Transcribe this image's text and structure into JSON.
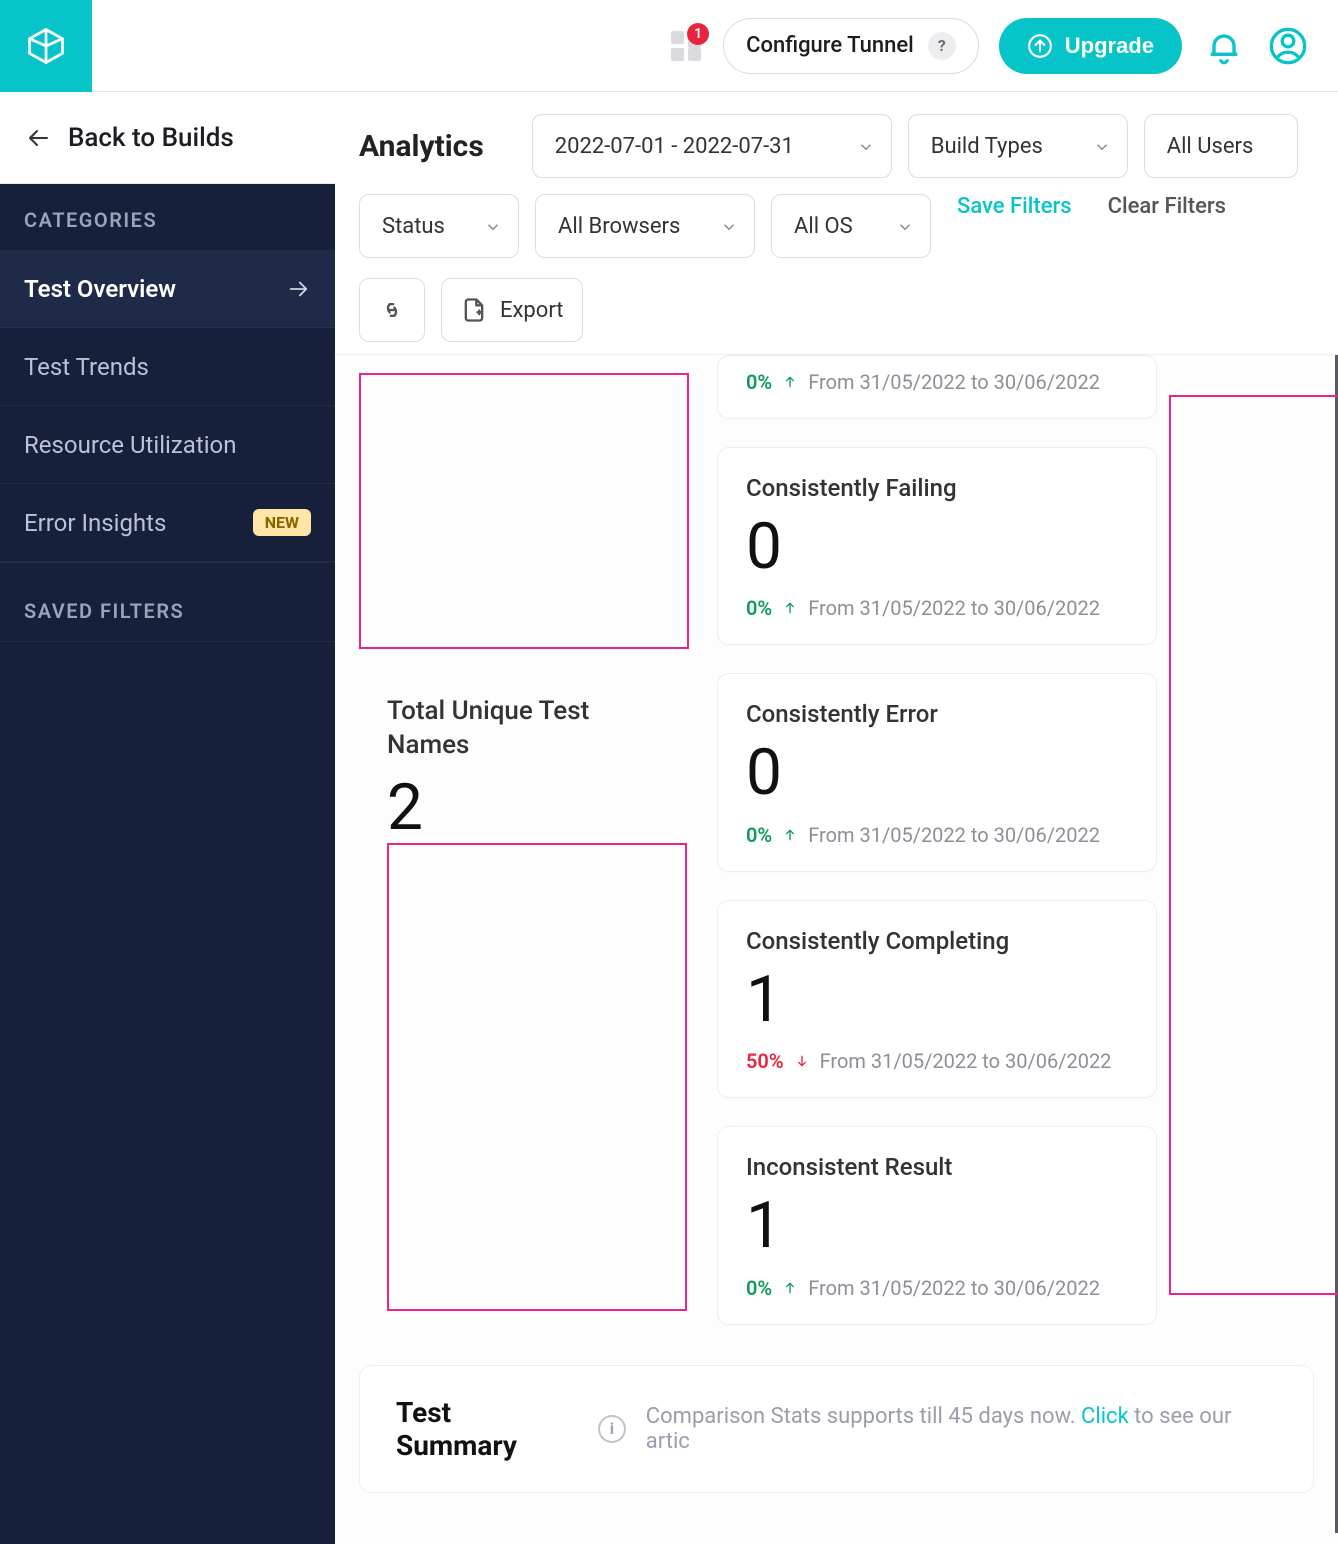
{
  "header": {
    "badge_count": "1",
    "configure_tunnel": "Configure Tunnel",
    "upgrade": "Upgrade"
  },
  "sidebar": {
    "back": "Back to Builds",
    "categories_label": "CATEGORIES",
    "saved_filters_label": "SAVED FILTERS",
    "items": [
      {
        "label": "Test Overview",
        "active": true
      },
      {
        "label": "Test Trends"
      },
      {
        "label": "Resource Utilization"
      },
      {
        "label": "Error Insights",
        "badge": "NEW"
      }
    ]
  },
  "toolbar": {
    "title": "Analytics",
    "date_range": "2022-07-01 - 2022-07-31",
    "build_types": "Build Types",
    "all_users": "All Users",
    "status": "Status",
    "all_browsers": "All Browsers",
    "all_os": "All OS",
    "save_filters": "Save Filters",
    "clear_filters": "Clear Filters",
    "export": "Export"
  },
  "left_card": {
    "title": "Total Unique Test Names",
    "value": "2"
  },
  "cards": [
    {
      "title": "",
      "value": "",
      "pct": "0%",
      "dir": "up",
      "range": "From 31/05/2022 to 30/06/2022",
      "partial": true
    },
    {
      "title": "Consistently Failing",
      "value": "0",
      "pct": "0%",
      "dir": "up",
      "range": "From 31/05/2022 to 30/06/2022"
    },
    {
      "title": "Consistently Error",
      "value": "0",
      "pct": "0%",
      "dir": "up",
      "range": "From 31/05/2022 to 30/06/2022"
    },
    {
      "title": "Consistently Completing",
      "value": "1",
      "pct": "50%",
      "dir": "down",
      "range": "From 31/05/2022 to 30/06/2022"
    },
    {
      "title": "Inconsistent Result",
      "value": "1",
      "pct": "0%",
      "dir": "up",
      "range": "From 31/05/2022 to 30/06/2022"
    }
  ],
  "summary": {
    "title": "Test Summary",
    "hint_prefix": "Comparison Stats supports till 45 days now. ",
    "hint_link": "Click",
    "hint_suffix": " to see our artic"
  }
}
